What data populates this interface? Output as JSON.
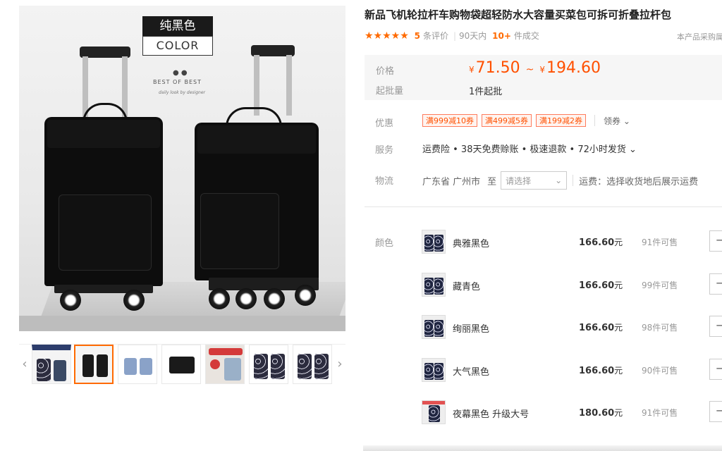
{
  "gallery": {
    "color_tag_cn": "纯黑色",
    "color_tag_en": "COLOR",
    "best_dots": "● ●",
    "best_text": "BEST OF BEST",
    "best_sub": "daily look by designer",
    "prev_arrow": "‹",
    "next_arrow": "›"
  },
  "product": {
    "title": "新品飞机轮拉杆车购物袋超轻防水大容量买菜包可拆可折叠拉杆包",
    "stars": "★★★★★",
    "review_count": "5",
    "review_label": "条评价",
    "days_label": "90天内",
    "deal_count": "10+",
    "deal_label": "件成交",
    "service_note": "本产品采购属"
  },
  "price": {
    "label": "价格",
    "currency": "¥",
    "low": "71.50",
    "tilde": "~",
    "high": "194.60",
    "moq_label": "起批量",
    "moq_value": "1件起批"
  },
  "promo": {
    "label": "优惠",
    "coupons": [
      "满999减10券",
      "满499减5券",
      "满199减2券"
    ],
    "get_coupon": "领券 ⌄"
  },
  "service": {
    "label": "服务",
    "text": "运费险 • 38天免费赊账 • 极速退款 • 72小时发货 ⌄"
  },
  "logistics": {
    "label": "物流",
    "origin": "广东省 广州市",
    "to": "至",
    "select_placeholder": "请选择",
    "freight": "运费：选择收货地后展示运费"
  },
  "sku": {
    "label": "颜色",
    "currency_unit": "元",
    "qty_button": "−",
    "items": [
      {
        "name": "典雅黑色",
        "price": "166.60",
        "stock": "91件可售"
      },
      {
        "name": "藏青色",
        "price": "166.60",
        "stock": "99件可售"
      },
      {
        "name": "绚丽黑色",
        "price": "166.60",
        "stock": "98件可售"
      },
      {
        "name": "大气黑色",
        "price": "166.60",
        "stock": "90件可售"
      },
      {
        "name": "夜幕黑色 升级大号",
        "price": "180.60",
        "stock": "91件可售"
      }
    ]
  },
  "colors": {
    "accent": "#ff6a00",
    "price": "#ff5000"
  }
}
